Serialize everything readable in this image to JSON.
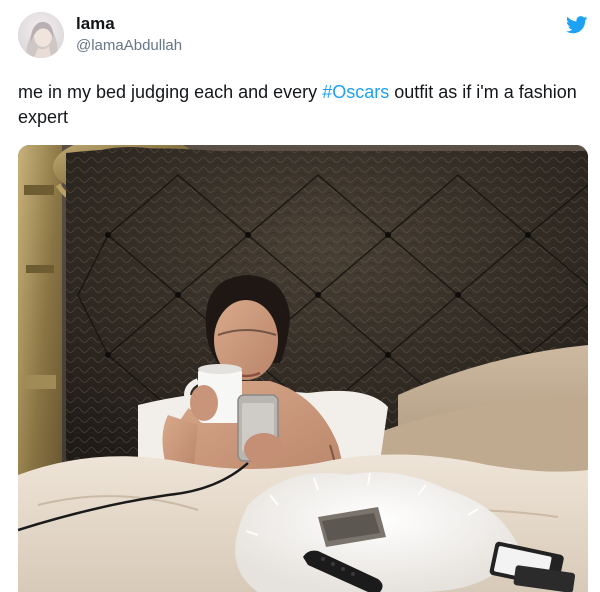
{
  "author": {
    "display_name": "lama",
    "handle": "@lamaAbdullah",
    "avatar_icon": "profile-avatar"
  },
  "brand": {
    "icon": "twitter-bird-icon",
    "color": "#1da1f2"
  },
  "tweet": {
    "text_before": "me in my bed judging each and every ",
    "hashtag": "#Oscars",
    "text_after": " outfit as if i'm a fashion expert",
    "hashtag_color": "#1da1f2"
  },
  "media": {
    "kind": "photo"
  }
}
